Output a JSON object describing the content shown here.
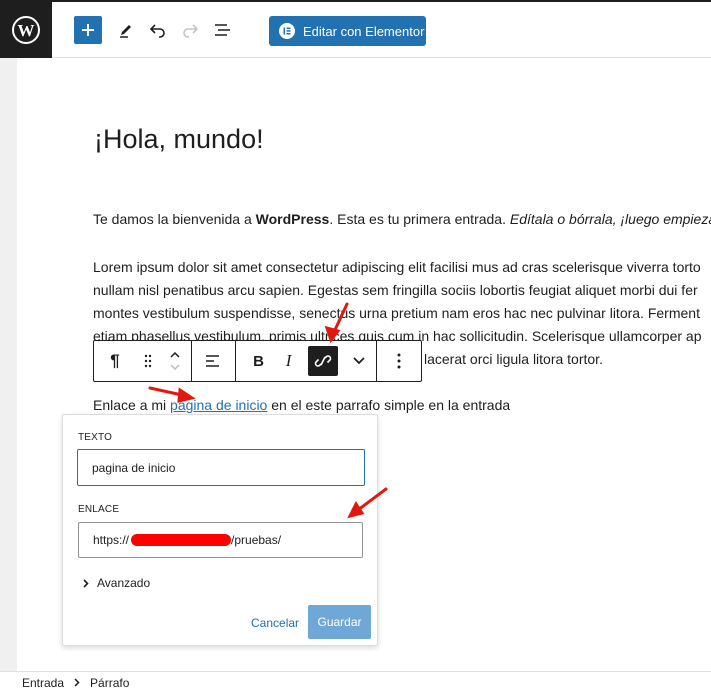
{
  "toolbar": {
    "elementor_label": "Editar con Elementor"
  },
  "post": {
    "title": "¡Hola, mundo!",
    "intro_before": "Te damos la bienvenida a ",
    "intro_bold": "WordPress",
    "intro_middle": ". Esta es tu primera entrada. ",
    "intro_italic": "Edítala o bórrala, ¡luego empieza",
    "lorem_lines": [
      "Lorem ipsum dolor sit amet consectetur adipiscing elit facilisi mus ad cras scelerisque viverra torto",
      "nullam nisl penatibus arcu sapien. Egestas sem fringilla sociis lobortis feugiat aliquet morbi dui fer",
      "montes vestibulum suspendisse, senectus urna pretium nam eros hac nec pulvinar litora. Ferment",
      "etiam phasellus vestibulum, primis ultrices quis cum in hac sollicitudin. Scelerisque ullamcorper ap"
    ],
    "lorem_tail": "lacerat orci ligula litora tortor.",
    "link_before": "Enlace a mi ",
    "link_text": "pagina de inicio",
    "link_after": " en el este parrafo simple en la entrada"
  },
  "link_popover": {
    "text_label": "TEXTO",
    "text_value": "pagina de inicio",
    "url_label": "ENLACE",
    "url_prefix": "https://",
    "url_suffix": "/pruebas/",
    "advanced_label": "Avanzado",
    "cancel_label": "Cancelar",
    "save_label": "Guardar"
  },
  "breadcrumb": {
    "root": "Entrada",
    "current": "Párrafo"
  },
  "colors": {
    "accent": "#2271b1",
    "dark": "#1e1e1e",
    "annotation": "#e0190f"
  }
}
